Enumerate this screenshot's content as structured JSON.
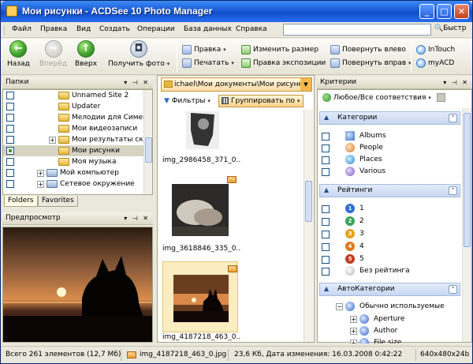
{
  "window": {
    "title": "Мои рисунки - ACDSee 10 Photo Manager"
  },
  "menu": [
    "Файл",
    "Правка",
    "Вид",
    "Создать",
    "Операции",
    "База данных",
    "Справка"
  ],
  "search": {
    "value": "",
    "button": "Быстр"
  },
  "toolbar": {
    "back": "Назад",
    "forward": "Вперёд",
    "up": "Вверх",
    "get_photos": "Получить фото",
    "edit": "Правка",
    "print": "Печатать",
    "resize": "Изменить размер",
    "exposure": "Правка экспозиции",
    "rotate_left": "Повернуть влево",
    "rotate_right": "Повернуть вправ",
    "intouch": "InTouch",
    "myacd": "myACD"
  },
  "folders_pane": {
    "title": "Папки",
    "items": [
      "Unnamed Site 2",
      "Updater",
      "Мелодии для Сименс",
      "Мои видеозаписи",
      "Мои результаты ска",
      "Мои рисунки",
      "Моя музыка",
      "Мой компьютер",
      "Сетевое окружение"
    ],
    "tabs": [
      "Folders",
      "Favorites"
    ]
  },
  "preview_pane": {
    "title": "Предпросмотр"
  },
  "browser": {
    "path": "ichael\\Мои документы\\Мои рисунки",
    "filters": "Фильтры",
    "group_by": "Группировать по",
    "thumbnails": [
      "img_2986458_371_0...",
      "img_3618846_335_0...",
      "img_4187218_463_0..."
    ]
  },
  "criteria_pane": {
    "title": "Критерии",
    "match": "Любое/Все соответствия",
    "categories_header": "Категории",
    "categories": [
      "Albums",
      "People",
      "Places",
      "Various"
    ],
    "ratings_header": "Рейтинги",
    "ratings": [
      "1",
      "2",
      "3",
      "4",
      "5",
      "Без рейтинга"
    ],
    "rating_colors": [
      "#2f6fd0",
      "#3aa35a",
      "#e3a21a",
      "#e07b20",
      "#c23b22"
    ],
    "auto_header": "АвтоКатегории",
    "auto_items": [
      "Обычно используемые",
      "Aperture",
      "Author",
      "File size"
    ]
  },
  "status": {
    "count": "Всего 261 элементов  (12,7 Мб)",
    "file": "img_4187218_463_0.jpg",
    "info": "23,6 Кб, Дата изменения: 16.03.2008 0:42:22",
    "dims": "640x480x24b"
  }
}
